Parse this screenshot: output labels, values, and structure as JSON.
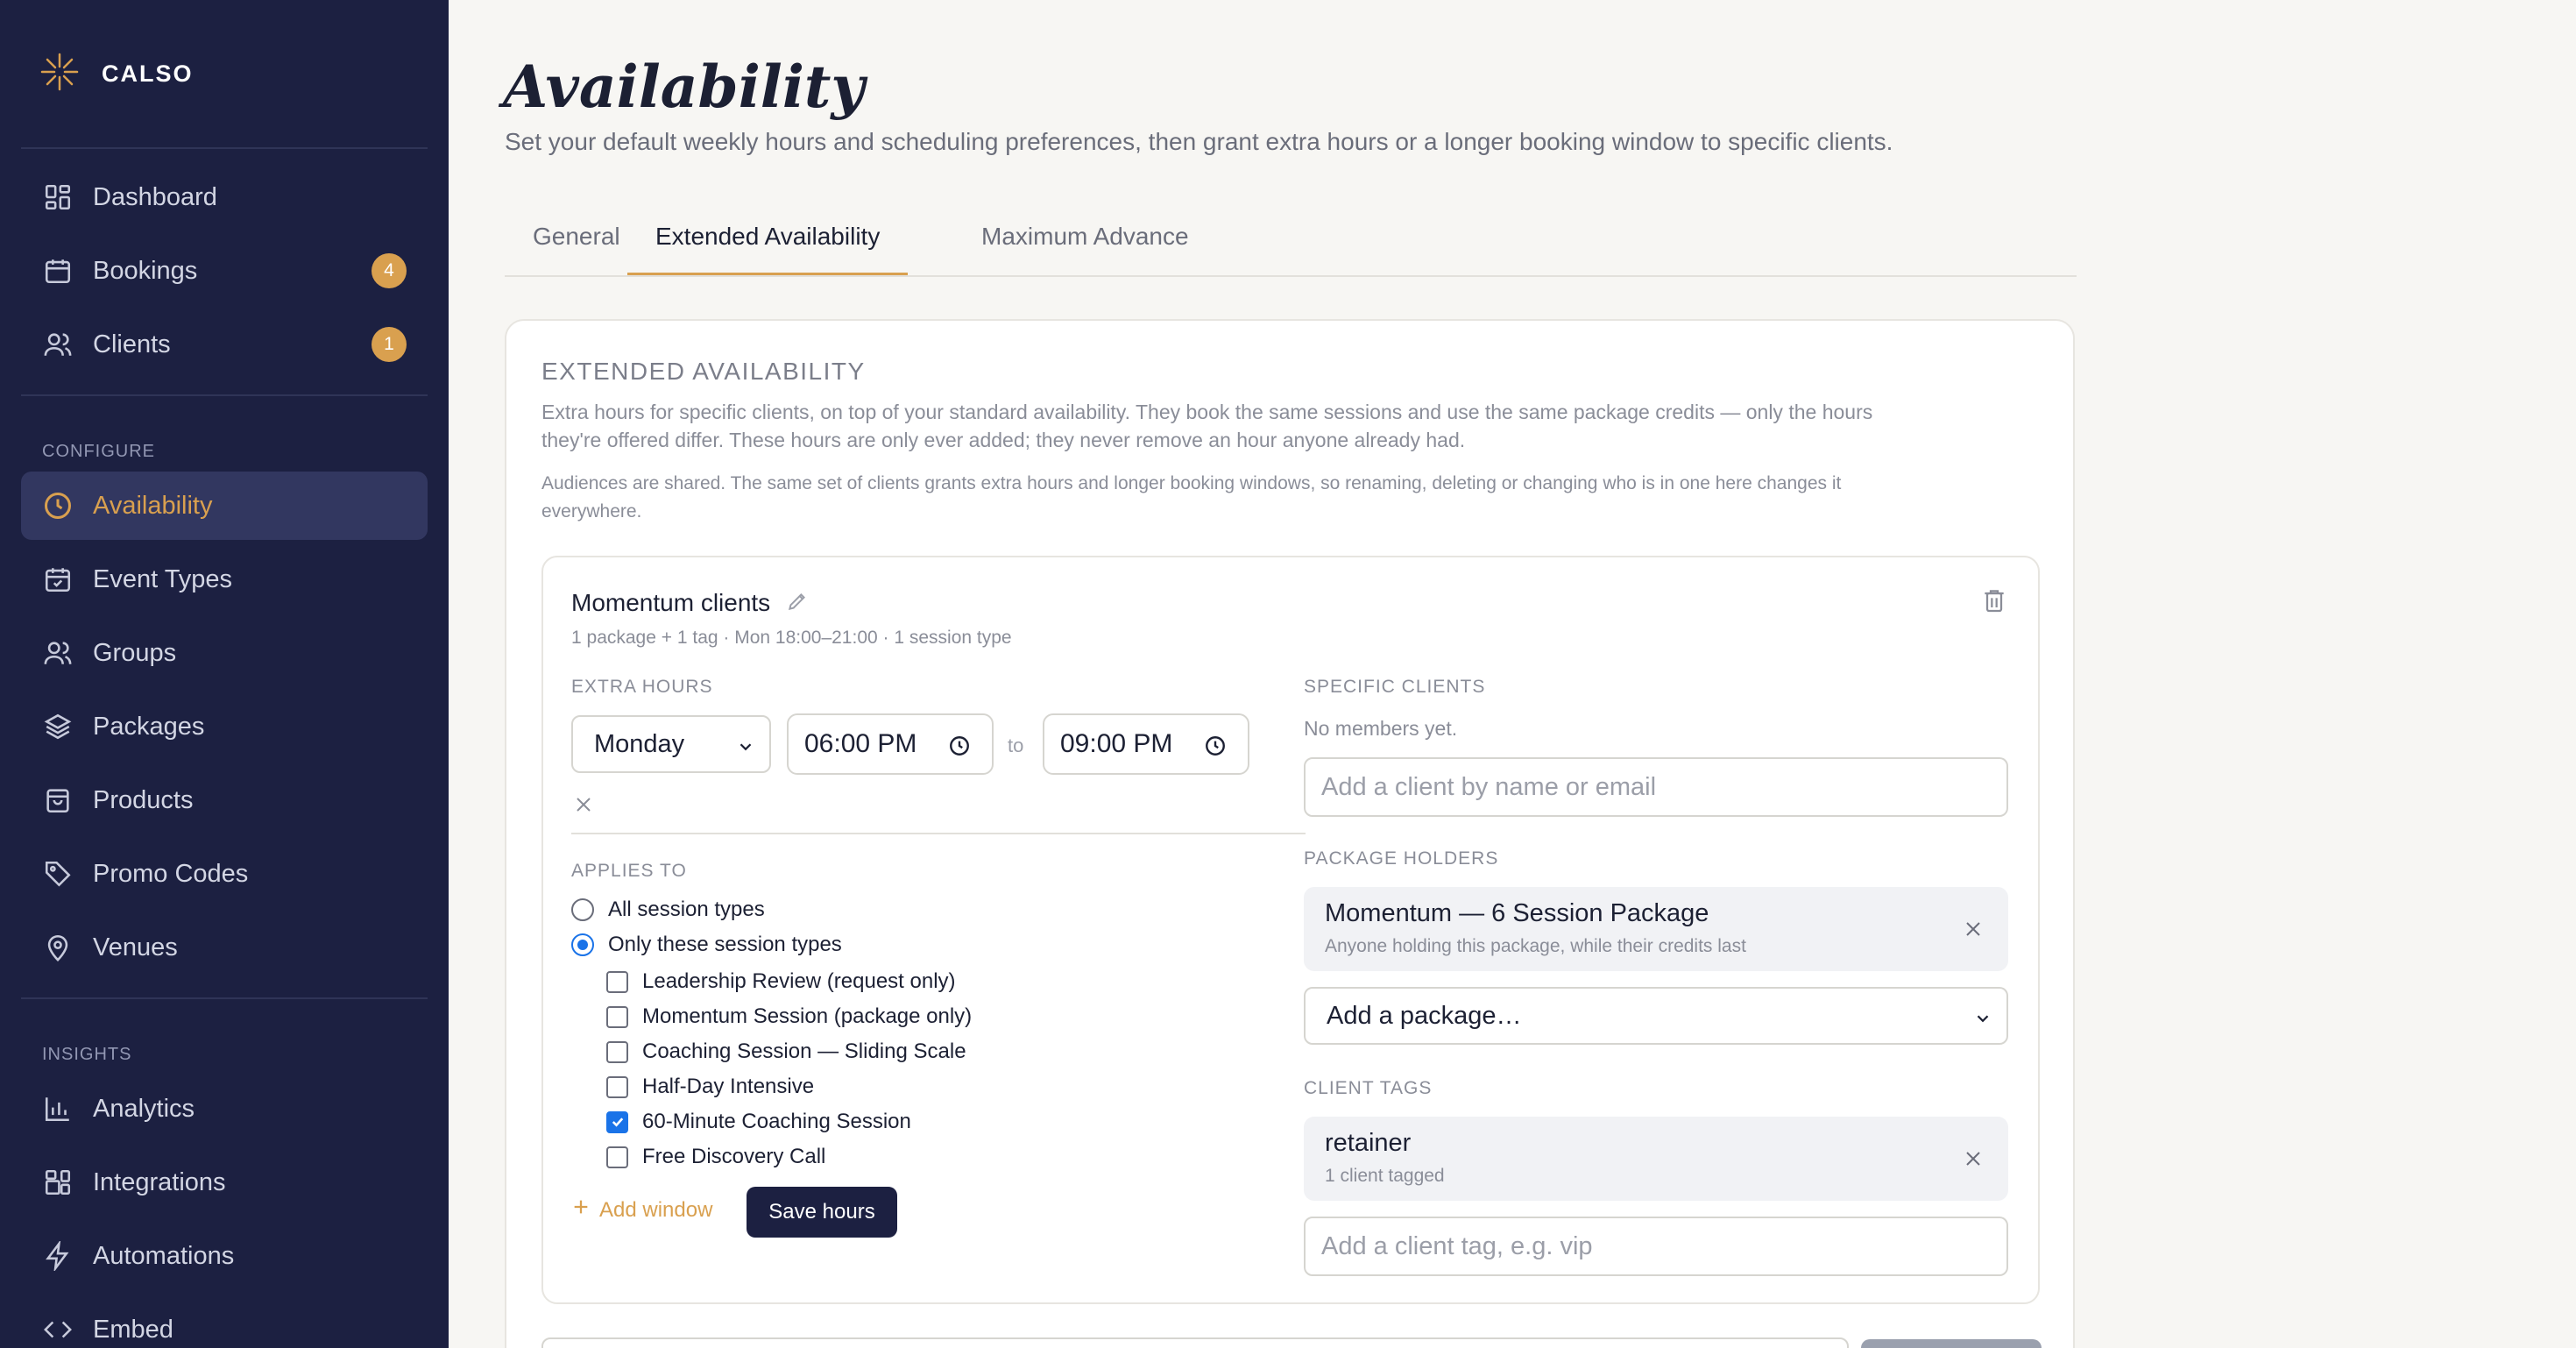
{
  "app": {
    "name": "CALSO"
  },
  "sidebar": {
    "items": [
      {
        "label": "Dashboard",
        "icon": "grid-icon"
      },
      {
        "label": "Bookings",
        "icon": "calendar-icon",
        "badge": "4"
      },
      {
        "label": "Clients",
        "icon": "users-icon",
        "badge": "1"
      }
    ],
    "configure_label": "CONFIGURE",
    "configure": [
      {
        "label": "Availability",
        "icon": "clock-icon",
        "active": true
      },
      {
        "label": "Event Types",
        "icon": "calendar-check-icon"
      },
      {
        "label": "Groups",
        "icon": "group-icon"
      },
      {
        "label": "Packages",
        "icon": "layers-icon"
      },
      {
        "label": "Products",
        "icon": "bag-icon"
      },
      {
        "label": "Promo Codes",
        "icon": "tag-icon"
      },
      {
        "label": "Venues",
        "icon": "map-pin-icon"
      }
    ],
    "insights_label": "INSIGHTS",
    "insights": [
      {
        "label": "Analytics",
        "icon": "bar-chart-icon"
      },
      {
        "label": "Integrations",
        "icon": "puzzle-icon"
      },
      {
        "label": "Automations",
        "icon": "bolt-icon"
      },
      {
        "label": "Embed",
        "icon": "code-icon"
      }
    ]
  },
  "page": {
    "title": "Availability",
    "subtitle": "Set your default weekly hours and scheduling preferences, then grant extra hours or a longer booking window to specific clients."
  },
  "tabs": [
    {
      "label": "General",
      "active": false
    },
    {
      "label": "Extended Availability",
      "active": true
    },
    {
      "label": "Maximum Advance",
      "active": false
    }
  ],
  "extended": {
    "heading": "EXTENDED AVAILABILITY",
    "description_line1": "Extra hours for specific clients, on top of your standard availability. They book the same sessions and use the same package credits — only the hours",
    "description_line2": "they're offered differ. These hours are only ever added; they never remove an hour anyone already had.",
    "note_line1": "Audiences are shared. The same set of clients grants extra hours and longer booking windows, so renaming, deleting or changing who is in one here changes it",
    "note_line2": "everywhere.",
    "audience": {
      "name": "Momentum clients",
      "summary": "1 package + 1 tag · Mon 18:00–21:00 · 1 session type",
      "extra_hours_label": "EXTRA HOURS",
      "day": "Monday",
      "start": "06:00 PM",
      "to_label": "to",
      "end": "09:00 PM",
      "applies_to_label": "APPLIES TO",
      "applies_options": [
        {
          "label": "All session types",
          "selected": false
        },
        {
          "label": "Only these session types",
          "selected": true
        }
      ],
      "session_types": [
        {
          "label": "Leadership Review (request only)",
          "checked": false
        },
        {
          "label": "Momentum Session (package only)",
          "checked": false
        },
        {
          "label": "Coaching Session — Sliding Scale",
          "checked": false
        },
        {
          "label": "Half-Day Intensive",
          "checked": false
        },
        {
          "label": "60-Minute Coaching Session",
          "checked": true
        },
        {
          "label": "Free Discovery Call",
          "checked": false
        }
      ],
      "add_window_label": "Add window",
      "save_label": "Save hours",
      "specific_clients_label": "SPECIFIC CLIENTS",
      "no_members": "No members yet.",
      "client_placeholder": "Add a client by name or email",
      "package_holders_label": "PACKAGE HOLDERS",
      "package_chip": {
        "title": "Momentum — 6 Session Package",
        "subtitle": "Anyone holding this package, while their credits last"
      },
      "package_select": "Add a package…",
      "client_tags_label": "CLIENT TAGS",
      "tag_chip": {
        "title": "retainer",
        "subtitle": "1 client tagged"
      },
      "tag_placeholder": "Add a client tag, e.g. vip"
    }
  },
  "colors": {
    "sidebar_bg": "#1c2041",
    "accent": "#d9a04f",
    "active_item_bg": "#323760",
    "checkbox": "#1a73e8",
    "page_bg": "#f7f6f3"
  }
}
